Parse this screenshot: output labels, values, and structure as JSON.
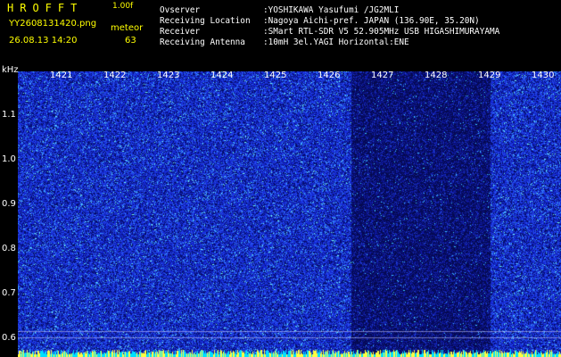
{
  "header": {
    "logo": "HROFFT",
    "version": "1.00f",
    "filename": "YY2608131420.png",
    "mode": "meteor",
    "datetime": "26.08.13 14:20",
    "count": "63"
  },
  "info": [
    {
      "label": "Ovserver",
      "value": ":YOSHIKAWA Yasufumi /JG2MLI"
    },
    {
      "label": "Receiving Location",
      "value": ":Nagoya Aichi-pref. JAPAN (136.90E, 35.20N)"
    },
    {
      "label": "Receiver",
      "value": ":SMart RTL-SDR V5 52.905MHz USB HIGASHIMURAYAMA"
    },
    {
      "label": "Receiving Antenna",
      "value": ":10mH 3el.YAGI Horizontal:ENE"
    }
  ],
  "spectrogram": {
    "unit": "kHz",
    "x_ticks": [
      "1421",
      "1422",
      "1423",
      "1424",
      "1425",
      "1426",
      "1427",
      "1428",
      "1429",
      "1430"
    ],
    "y_ticks": [
      "1.1",
      "1.0",
      "0.9",
      "0.8",
      "0.7",
      "0.6"
    ],
    "colors": {
      "background": "#000000",
      "noise_dark": "#0a1360",
      "noise_mid": "#1e3ce0",
      "noise_bright": "#4fe0ff",
      "text_yellow": "#ffff00",
      "text_cyan": "#00ffff"
    }
  }
}
